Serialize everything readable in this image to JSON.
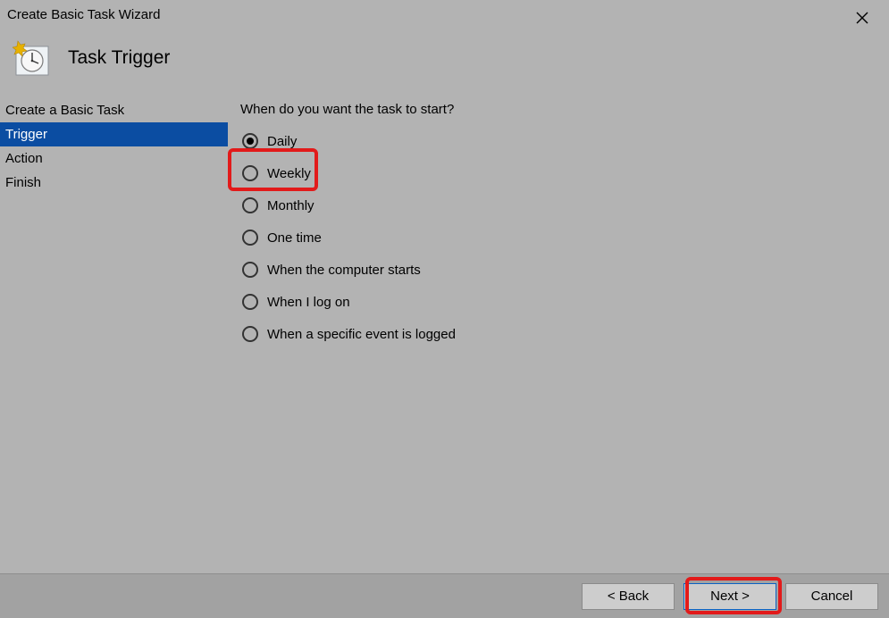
{
  "window": {
    "title": "Create Basic Task Wizard"
  },
  "header": {
    "heading": "Task Trigger"
  },
  "sidebar": {
    "items": [
      {
        "label": "Create a Basic Task",
        "selected": false
      },
      {
        "label": "Trigger",
        "selected": true
      },
      {
        "label": "Action",
        "selected": false
      },
      {
        "label": "Finish",
        "selected": false
      }
    ]
  },
  "main": {
    "question": "When do you want the task to start?",
    "options": [
      {
        "label": "Daily",
        "checked": true
      },
      {
        "label": "Weekly",
        "checked": false
      },
      {
        "label": "Monthly",
        "checked": false
      },
      {
        "label": "One time",
        "checked": false
      },
      {
        "label": "When the computer starts",
        "checked": false
      },
      {
        "label": "When I log on",
        "checked": false
      },
      {
        "label": "When a specific event is logged",
        "checked": false
      }
    ]
  },
  "buttons": {
    "back": "< Back",
    "next": "Next >",
    "cancel": "Cancel"
  }
}
